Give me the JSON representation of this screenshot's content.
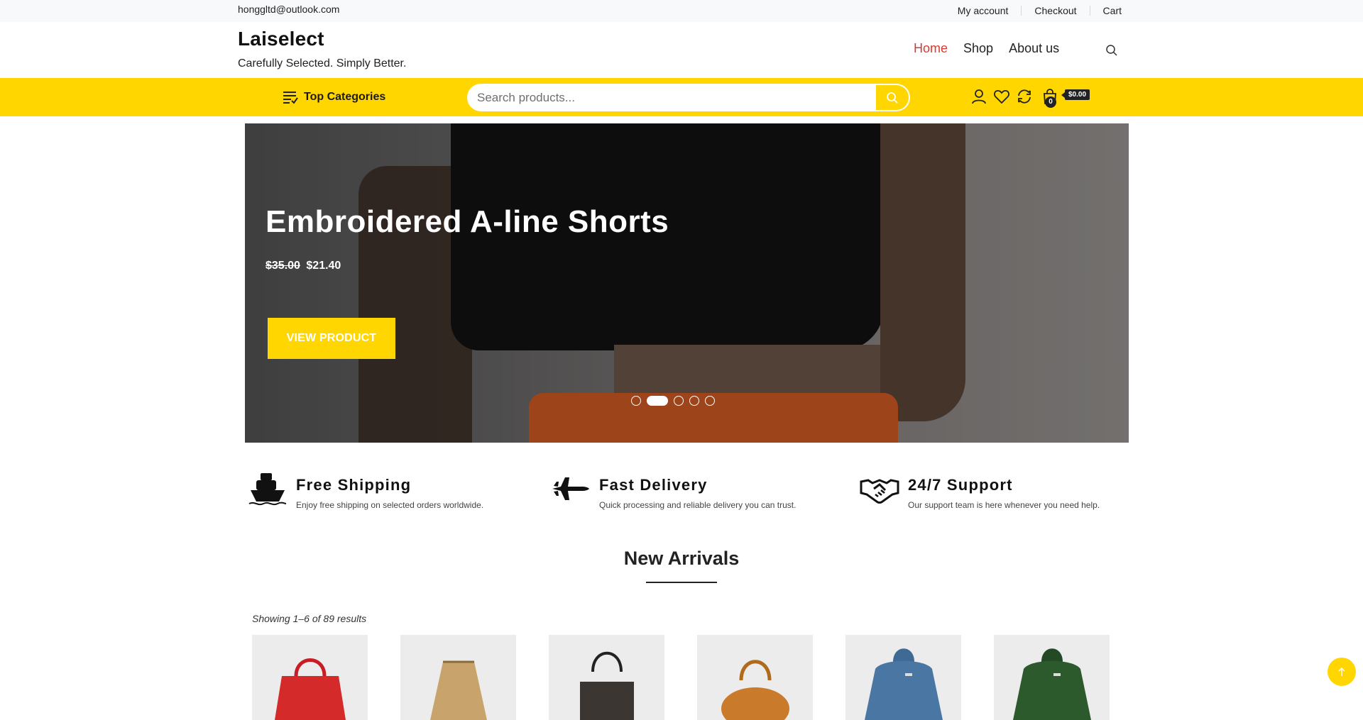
{
  "topbar": {
    "email": "honggltd@outlook.com",
    "links": [
      "My account",
      "Checkout",
      "Cart"
    ]
  },
  "header": {
    "brand": "Laiselect",
    "tagline": "Carefully Selected. Simply Better.",
    "nav": [
      {
        "label": "Home",
        "active": true
      },
      {
        "label": "Shop",
        "active": false
      },
      {
        "label": "About us",
        "active": false
      }
    ]
  },
  "yellowbar": {
    "categories_label": "Top Categories",
    "search_placeholder": "Search products...",
    "cart_count": "0",
    "cart_total": "$0.00"
  },
  "hero": {
    "title": "Embroidered A-line Shorts",
    "old_price": "$35.00",
    "new_price": "$21.40",
    "button_label": "VIEW PRODUCT",
    "slides": 5,
    "active_slide": 2
  },
  "features": [
    {
      "icon": "ship-icon",
      "title": "Free Shipping",
      "desc": "Enjoy free shipping on selected orders worldwide."
    },
    {
      "icon": "jet-icon",
      "title": "Fast Delivery",
      "desc": "Quick processing and reliable delivery you can trust."
    },
    {
      "icon": "handshake-icon",
      "title": "24/7 Support",
      "desc": "Our support team is here whenever you need help."
    }
  ],
  "new_arrivals": {
    "title": "New Arrivals",
    "results_text": "Showing 1–6 of 89 results"
  },
  "colors": {
    "accent_yellow": "#ffd600",
    "active_nav": "#d63b32"
  }
}
